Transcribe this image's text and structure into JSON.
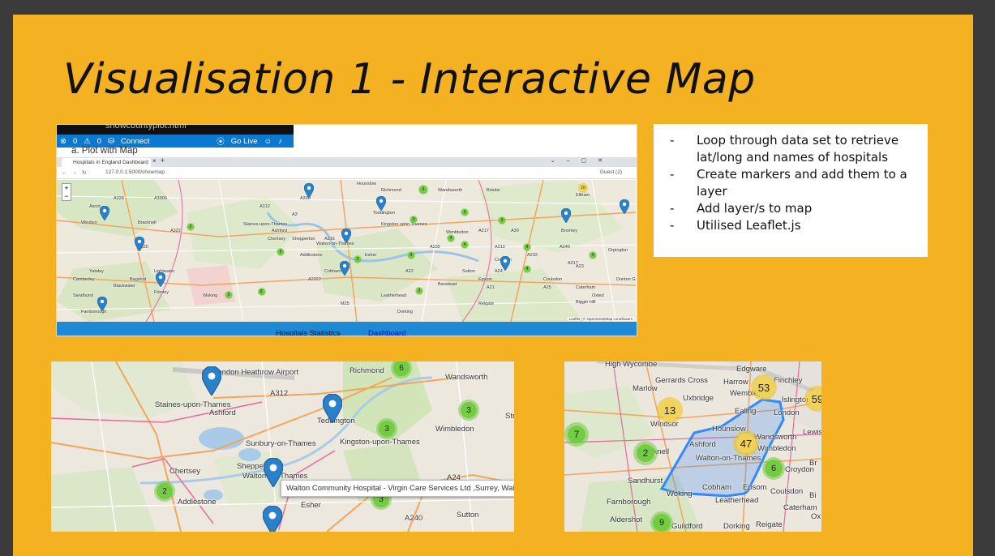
{
  "slide": {
    "title": "Visualisation 1 - Interactive Map"
  },
  "editor": {
    "file_name": "showcountyplot.html",
    "status_errors": "0",
    "status_warnings": "0",
    "status_connect": "Connect",
    "status_golive": "Go Live",
    "note": "a.  Plot with Map"
  },
  "browser": {
    "tab_title": "Hospitals in England Dashboard",
    "url": "127.0.0.1:5000/showmap",
    "profile": "Guest (2)"
  },
  "main_map": {
    "places": [
      "Hounslow",
      "Richmond",
      "Wandsworth",
      "Brixton",
      "Eltham",
      "Windsor",
      "Staines-upon-Thames",
      "Ashford",
      "Teddington",
      "Kingston upon Thames",
      "Wimbledon",
      "Croydon",
      "Bromley",
      "Bracknell",
      "Chertsey",
      "Shepperton",
      "Walton-on-Thames",
      "Addlestone",
      "Esher",
      "Sutton",
      "Orpington",
      "Woking",
      "Leatherhead",
      "Cobham",
      "Epsom",
      "Banstead",
      "Camberley",
      "Farnborough",
      "Yateley",
      "Blackwater",
      "Frimley",
      "Coulsdon",
      "Caterham",
      "Oxted",
      "Reigate",
      "Dorking",
      "Biggin Hill",
      "Dunton Green",
      "Sandhurst",
      "Ascot",
      "Bagshot",
      "Lightwater",
      "A312",
      "A3",
      "A316",
      "A320",
      "A322",
      "A329",
      "A330",
      "A30",
      "A317",
      "A240",
      "A24",
      "A217",
      "A22",
      "A21",
      "A23",
      "A25",
      "A232",
      "A233",
      "A212",
      "A2022",
      "A3006",
      "M25"
    ],
    "clusters": [
      "6",
      "10",
      "2",
      "3",
      "3",
      "3",
      "4",
      "4",
      "2",
      "4",
      "4",
      "4",
      "2",
      "4",
      "2",
      "2",
      "2",
      "2"
    ],
    "attribution": "Leaflet | © OpenStreetMap contributors"
  },
  "footer": {
    "title": "Hospitals Statistics",
    "link": "Dashboard"
  },
  "bullets": [
    "Loop through data set to retrieve lat/long and names of hospitals",
    "Create markers and add them to a layer",
    "Add layer/s to map",
    "Utilised Leaflet.js"
  ],
  "zoom_map": {
    "places": [
      "London Heathrow Airport",
      "Richmond",
      "Wandsworth",
      "A312",
      "Staines-upon-Thames",
      "Ashford",
      "Teddington",
      "Kingston-upon-Thames",
      "Wimbledon",
      "Sunbury-on-Thames",
      "Shepperton",
      "Chertsey",
      "Walton-on-Thames",
      "Addlestone",
      "Esher",
      "A240",
      "A24",
      "Sutton",
      "Str"
    ],
    "clusters": [
      "6",
      "3",
      "3",
      "2",
      "3"
    ],
    "tooltip": "Walton Community Hospital - Virgin Care Services Ltd ,Surrey, Walton"
  },
  "poly_map": {
    "places": [
      "High Wycombe",
      "Marlow",
      "Gerrards Cross",
      "Harrow",
      "Finchley",
      "Edgware",
      "Uxbridge",
      "Wembley",
      "Islington",
      "London",
      "Windsor",
      "Hounslow",
      "Ealing",
      "Bracknell",
      "Ashford",
      "Wandsworth",
      "Walton-on-Thames",
      "Wimbledon",
      "Croydon",
      "Sandhurst",
      "Woking",
      "Cobham",
      "Epsom",
      "Coulsdon",
      "Farnborough",
      "Leatherhead",
      "Caterham",
      "Aldershot",
      "Guildford",
      "Dorking",
      "Reigate",
      "Lewis",
      "Bi",
      "Br",
      "Ox"
    ],
    "clusters": [
      "53",
      "59",
      "13",
      "7",
      "47",
      "2",
      "6",
      "9"
    ]
  },
  "colors": {
    "slide_bg": "#f4b223",
    "window_bg": "#3b3b3c",
    "marker": "#2a81cb",
    "cluster_green": "#6ecc39",
    "cluster_yellow": "#f1d357",
    "polygon": "#3388ff",
    "status_bar": "#0b79d0",
    "footer_bar": "#1e8ad6"
  }
}
